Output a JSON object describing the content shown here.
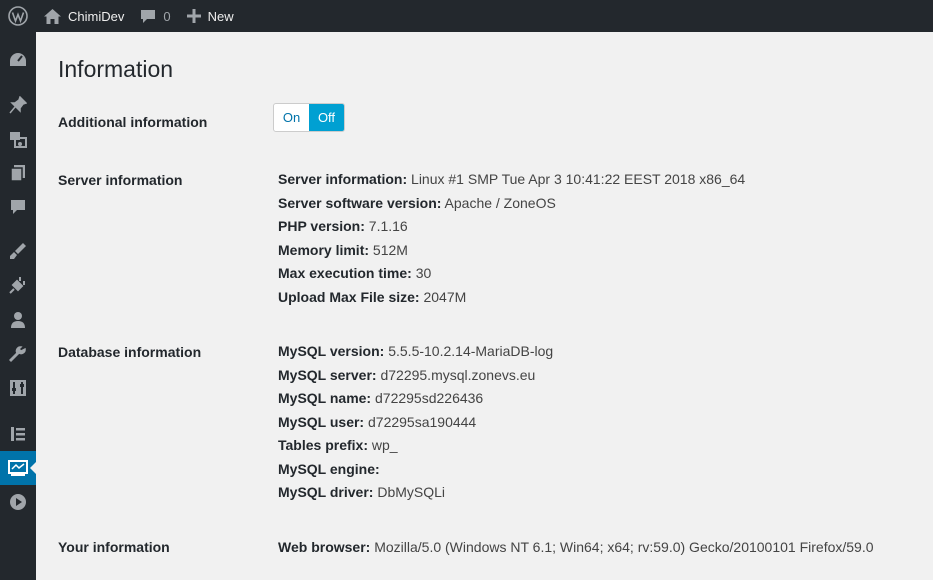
{
  "adminbar": {
    "site_name": "ChimiDev",
    "comments_count": "0",
    "new_label": "New"
  },
  "page": {
    "title": "Information"
  },
  "additional": {
    "label": "Additional information",
    "on_label": "On",
    "off_label": "Off",
    "selected": "Off"
  },
  "server": {
    "label": "Server information",
    "fields": [
      {
        "key": "Server information:",
        "value": "Linux #1 SMP Tue Apr 3 10:41:22 EEST 2018 x86_64"
      },
      {
        "key": "Server software version:",
        "value": "Apache / ZoneOS"
      },
      {
        "key": "PHP version:",
        "value": "7.1.16"
      },
      {
        "key": "Memory limit:",
        "value": "512M"
      },
      {
        "key": "Max execution time:",
        "value": "30"
      },
      {
        "key": "Upload Max File size:",
        "value": "2047M"
      }
    ]
  },
  "database": {
    "label": "Database information",
    "fields": [
      {
        "key": "MySQL version:",
        "value": "5.5.5-10.2.14-MariaDB-log"
      },
      {
        "key": "MySQL server:",
        "value": "d72295.mysql.zonevs.eu"
      },
      {
        "key": "MySQL name:",
        "value": "d72295sd226436"
      },
      {
        "key": "MySQL user:",
        "value": "d72295sa190444"
      },
      {
        "key": "Tables prefix:",
        "value": "wp_"
      },
      {
        "key": "MySQL engine:",
        "value": ""
      },
      {
        "key": "MySQL driver:",
        "value": "DbMySQLi"
      }
    ]
  },
  "your_info": {
    "label": "Your information",
    "fields": [
      {
        "key": "Web browser:",
        "value": "Mozilla/5.0 (Windows NT 6.1; Win64; x64; rv:59.0) Gecko/20100101 Firefox/59.0"
      }
    ]
  },
  "sidebar": {
    "icons": [
      "dashboard-icon",
      "pin-icon",
      "media-icon",
      "pages-icon",
      "comments-icon",
      "appearance-icon",
      "plugins-icon",
      "users-icon",
      "tools-icon",
      "settings-icon",
      "list-icon",
      "info-icon",
      "play-icon"
    ],
    "active": "info-icon"
  },
  "colors": {
    "adminbar_bg": "#23282d",
    "accent": "#0073aa",
    "toggle_selected": "#00a0d2",
    "page_bg": "#f1f1f1"
  }
}
